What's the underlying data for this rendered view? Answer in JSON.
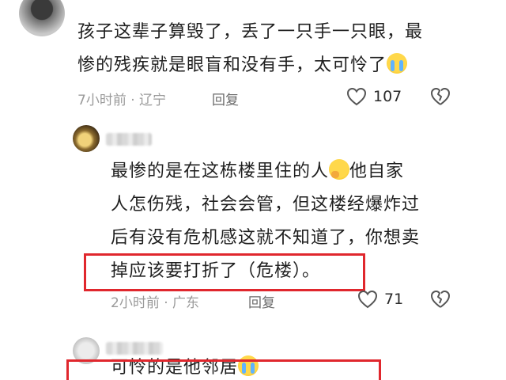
{
  "comments": [
    {
      "lines": [
        "孩子这辈子算毁了，丢了一只手一只眼，最",
        "惨的残疾就是眼盲和没有手，太可怜了"
      ],
      "emoji": "loudly-crying-face",
      "time_location": "7小时前 · 辽宁",
      "reply_label": "回复",
      "like_count": "107"
    },
    {
      "lines": [
        "最惨的是在这栋楼里住的人",
        "他自家",
        "人怎伤残，社会会管，但这楼经爆炸过",
        "后有没有危机感这就不知道了，你想卖",
        "掉应该要打折了（危楼）。"
      ],
      "emoji": "thinking-face",
      "time_location": "2小时前 · 广东",
      "reply_label": "回复",
      "like_count": "71"
    },
    {
      "lines": [
        "可怜的是他邻居"
      ],
      "emoji": "sweat-smile-face"
    }
  ],
  "colors": {
    "highlight": "#e0272d",
    "meta": "#9a9a9a",
    "text": "#1f1f1f"
  },
  "icons": {
    "like": "heart-outline-icon",
    "dislike": "broken-heart-outline-icon"
  }
}
